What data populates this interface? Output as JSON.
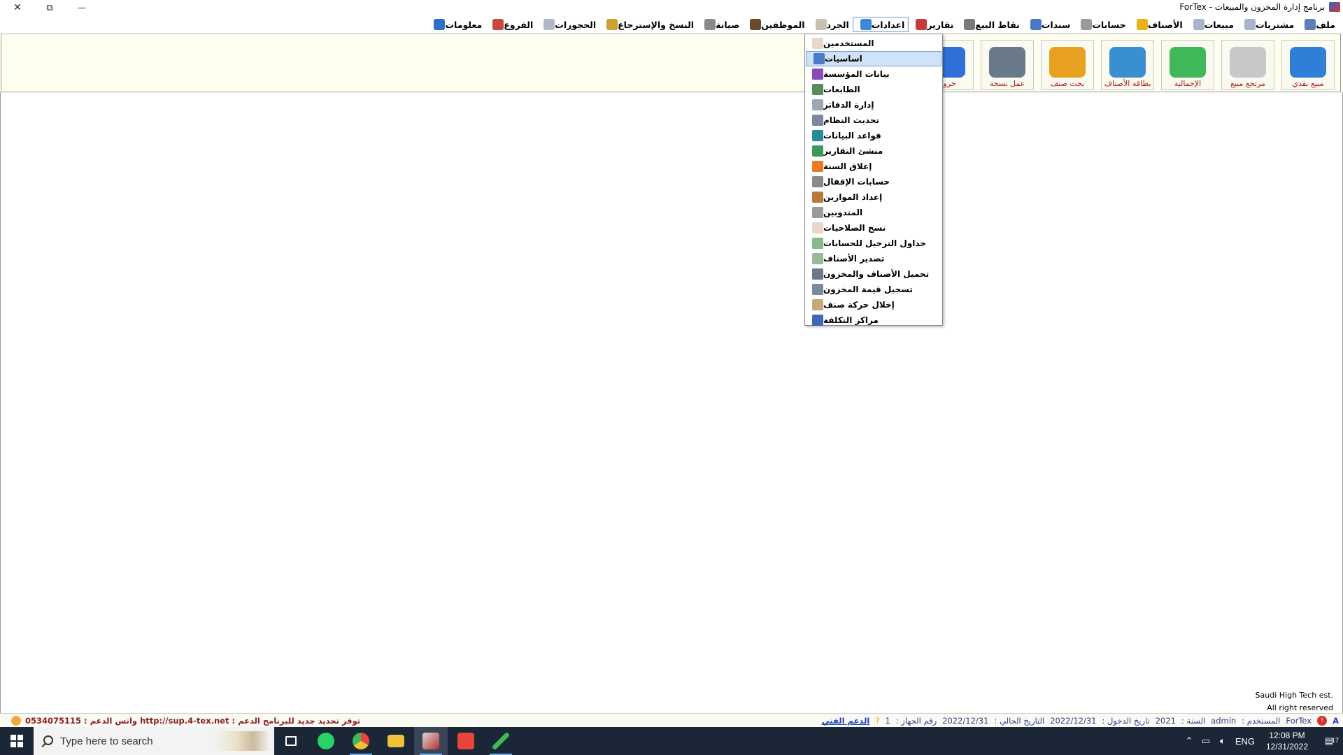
{
  "window": {
    "title": "برنامج إدارة المخزون والمبيعات - ForTex",
    "close_glyph": "✕",
    "restore_glyph": "⧉",
    "minimize_glyph": "—"
  },
  "menubar": {
    "items": [
      {
        "label": "ملف",
        "icon": "file-app-icon",
        "color": "#5b7fb8"
      },
      {
        "label": "مشتريات",
        "icon": "purchases-icon",
        "color": "#a8b4c8"
      },
      {
        "label": "مبيعات",
        "icon": "sales-icon",
        "color": "#a8b4c8"
      },
      {
        "label": "الأصناف",
        "icon": "items-icon",
        "color": "#e8b21a"
      },
      {
        "label": "حسابات",
        "icon": "accounts-icon",
        "color": "#9a9a9a"
      },
      {
        "label": "سندات",
        "icon": "vouchers-icon",
        "color": "#4a78c8"
      },
      {
        "label": "نقاط البيع",
        "icon": "pos-icon",
        "color": "#7a7a7a"
      },
      {
        "label": "تقارير",
        "icon": "reports-icon",
        "color": "#c83a3a"
      },
      {
        "label": "اعدادات",
        "icon": "settings-globe-icon",
        "color": "#3f86d4"
      },
      {
        "label": "الجرد",
        "icon": "inventory-icon",
        "color": "#c8c0b0"
      },
      {
        "label": "الموظفين",
        "icon": "employees-icon",
        "color": "#6a4a2a"
      },
      {
        "label": "صيانة",
        "icon": "maintenance-icon",
        "color": "#8a8a8a"
      },
      {
        "label": "النسخ والإسترجاع",
        "icon": "backup-restore-icon",
        "color": "#d0a030"
      },
      {
        "label": "الحجوزات",
        "icon": "reservations-icon",
        "color": "#b0b8c8"
      },
      {
        "label": "الفروع",
        "icon": "branches-icon",
        "color": "#c84a3a"
      },
      {
        "label": "معلومات",
        "icon": "info-icon",
        "color": "#2f6fc8"
      }
    ]
  },
  "toolbar": {
    "buttons": [
      {
        "label": "مبيع نقدي",
        "icon": "cash-sale-icon",
        "color": "#2f7fd8"
      },
      {
        "label": "مرتجع مبيع",
        "icon": "sales-return-icon",
        "color": "#c8c8c8"
      },
      {
        "label": "الإجمالية",
        "icon": "totals-icon",
        "color": "#3fb85a"
      },
      {
        "label": "بطاقة الأصناف",
        "icon": "item-card-icon",
        "color": "#3a8fd0"
      },
      {
        "label": "بحث صنف",
        "icon": "search-item-icon",
        "color": "#e8a020"
      },
      {
        "label": "عمل نسخة",
        "icon": "make-backup-icon",
        "color": "#6a7a8a"
      },
      {
        "label": "خروج",
        "icon": "exit-lock-icon",
        "color": "#2f6fd8"
      }
    ]
  },
  "dropdown": {
    "items": [
      {
        "label": "المستخدمين",
        "icon": "users-icon",
        "color": "#e8d8c8"
      },
      {
        "label": "اساسيات",
        "icon": "basics-icon",
        "color": "#4a7ac8"
      },
      {
        "label": "بيانات المؤسسة",
        "icon": "company-data-icon",
        "color": "#8a4ab8"
      },
      {
        "label": "الطابعات",
        "icon": "printers-icon",
        "color": "#5a8a5a"
      },
      {
        "label": "إدارة الدفاتر",
        "icon": "books-icon",
        "color": "#9aa8b8"
      },
      {
        "label": "تحديث النظام",
        "icon": "update-icon",
        "color": "#7a8a9a"
      },
      {
        "label": "قواعد البيانات",
        "icon": "database-icon",
        "color": "#2a8a9a"
      },
      {
        "label": "منشئ التقارير",
        "icon": "report-builder-icon",
        "color": "#3a9a5a"
      },
      {
        "label": "إغلاق السنة",
        "icon": "close-year-icon",
        "color": "#e87a2a"
      },
      {
        "label": "حسابات الإقفال",
        "icon": "closing-accounts-icon",
        "color": "#8a8a8a"
      },
      {
        "label": "إعداد الموازين",
        "icon": "scales-icon",
        "color": "#b87a3a"
      },
      {
        "label": "المندوبين",
        "icon": "delegates-icon",
        "color": "#9a9a9a"
      },
      {
        "label": "نسخ الصلاحيات",
        "icon": "copy-permissions-icon",
        "color": "#e8d8c8"
      },
      {
        "label": "جداول الترحيل للحسابات",
        "icon": "posting-tables-icon",
        "color": "#8ab88a"
      },
      {
        "label": "تصدير الأصناف",
        "icon": "export-items-icon",
        "color": "#9ab89a"
      },
      {
        "label": "تحميل الأصناف والمخزون",
        "icon": "load-items-icon",
        "color": "#6a7a8a"
      },
      {
        "label": "تسجيل قيمة المخزون",
        "icon": "stock-value-icon",
        "color": "#7a8a9a"
      },
      {
        "label": "إخلال حركة صنف",
        "icon": "item-movement-icon",
        "color": "#c8a87a"
      },
      {
        "label": "مراكز التكلفة",
        "icon": "cost-centers-icon",
        "color": "#3a6ab8"
      }
    ],
    "selected_index": 1
  },
  "copyright": {
    "line1": "Saudi High Tech est.",
    "line2": "All right reserved"
  },
  "statusbar": {
    "notice": "توفر تحديد جديد للبرنامج  الدعم : http://sup.4-tex.net  واتس الدعم : 0534075115",
    "app_name": "ForTex",
    "user_label": "المستخدم :",
    "user_value": "admin",
    "year_label": "السنة :",
    "year_value": "2021",
    "login_date_label": "تاريخ الدخول :",
    "login_date_value": "2022/12/31",
    "current_date_label": "التاريخ الحالي :",
    "current_date_value": "2022/12/31",
    "device_label": "رقم الجهاز :",
    "device_value": "1",
    "support_link": "الدعم الفني",
    "badge_letter": "A"
  },
  "taskbar": {
    "search_placeholder": "Type here to search",
    "apps": [
      {
        "name": "task-view",
        "color": "#ffffff"
      },
      {
        "name": "whatsapp",
        "color": "#25d366"
      },
      {
        "name": "chrome",
        "color": "#e8453c"
      },
      {
        "name": "file-explorer",
        "color": "#f2c13a"
      },
      {
        "name": "fortex",
        "color": "#d8d8d8"
      },
      {
        "name": "anydesk",
        "color": "#e8453c"
      },
      {
        "name": "pen-app",
        "color": "#3fb85a"
      }
    ],
    "language": "ENG",
    "time": "12:08 PM",
    "date": "12/31/2022",
    "notification_count": "17"
  }
}
